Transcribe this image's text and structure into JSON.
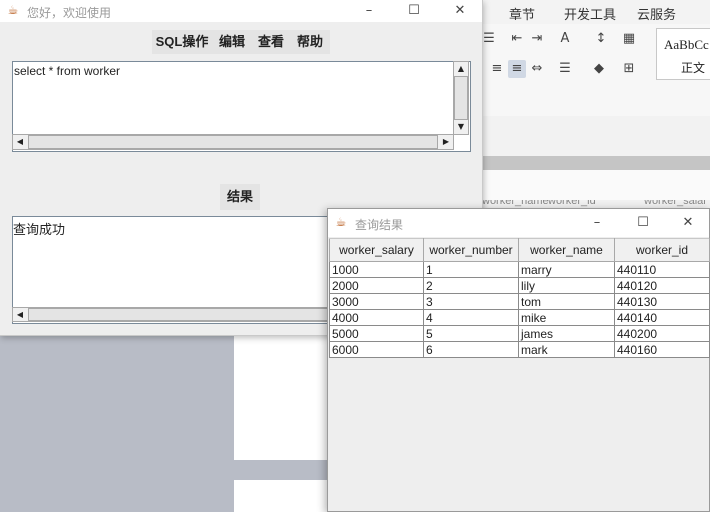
{
  "background_app": {
    "menu": [
      "章节",
      "开发工具",
      "云服务"
    ],
    "style_preview": "AaBbCc",
    "style_name": "正文",
    "table_header_fragments": [
      "worker_name",
      "worker_id",
      "worker_salar"
    ]
  },
  "main_window": {
    "title": "您好，欢迎使用",
    "menu": [
      "SQL操作",
      "编辑",
      "查看",
      "帮助"
    ],
    "query_text": "select * from worker",
    "result_button": "结果",
    "status_text": "查询成功"
  },
  "result_window": {
    "title": "查询结果",
    "columns": [
      "worker_salary",
      "worker_number",
      "worker_name",
      "worker_id"
    ],
    "rows": [
      [
        "1000",
        "1",
        "marry",
        "440110"
      ],
      [
        "2000",
        "2",
        "lily",
        "440120"
      ],
      [
        "3000",
        "3",
        "tom",
        "440130"
      ],
      [
        "4000",
        "4",
        "mike",
        "440140"
      ],
      [
        "5000",
        "5",
        "james",
        "440200"
      ],
      [
        "6000",
        "6",
        "mark",
        "440160"
      ]
    ]
  },
  "icons": {
    "minimize": "minimize-icon",
    "maximize": "maximize-icon",
    "close": "close-icon",
    "java": "java-cup-icon"
  }
}
